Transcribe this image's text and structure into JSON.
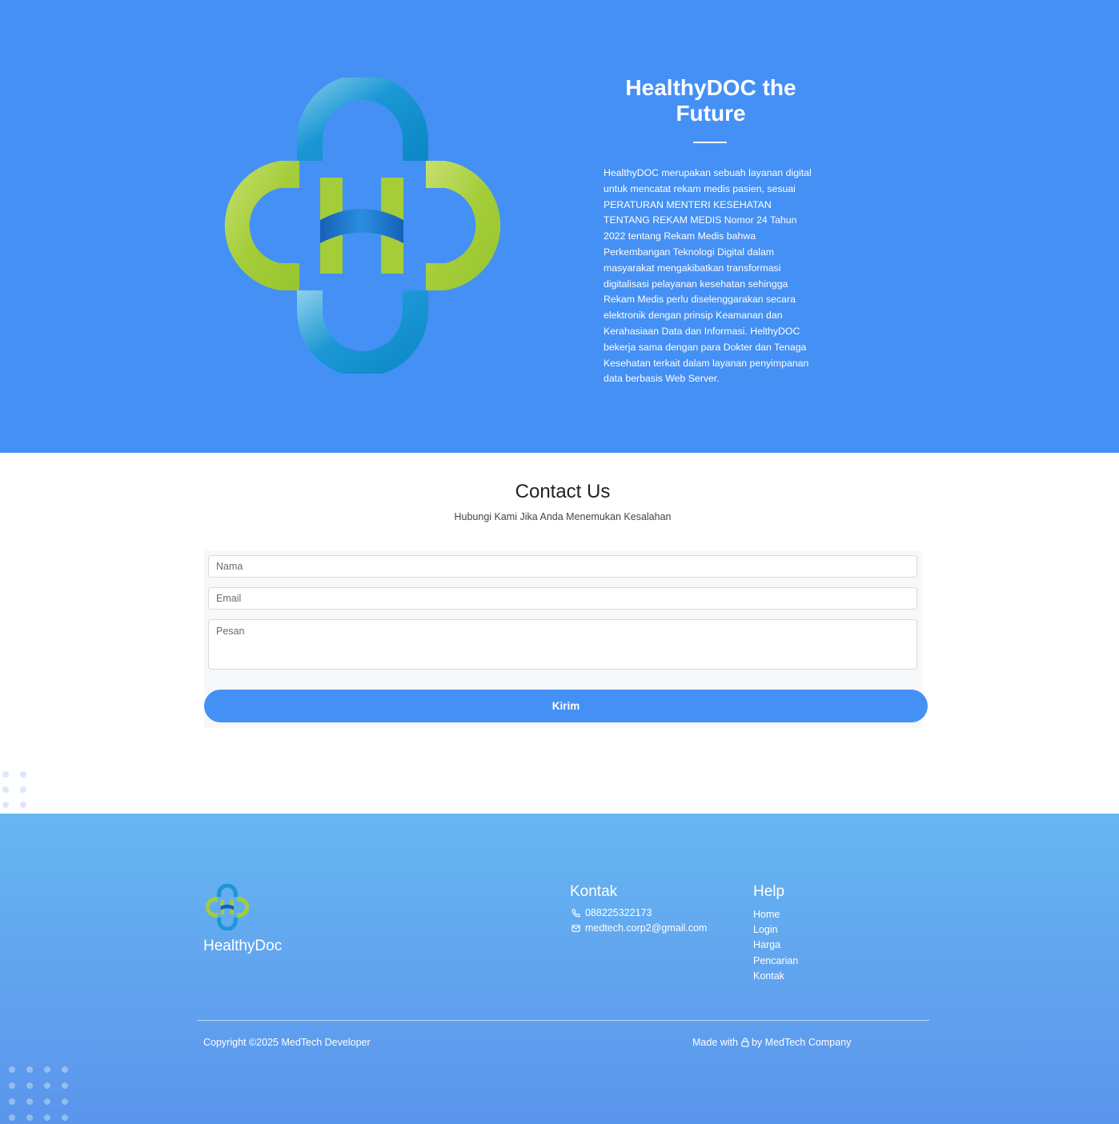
{
  "hero": {
    "title": "HealthyDOC the Future",
    "description": "HealthyDOC merupakan sebuah layanan digital untuk mencatat rekam medis pasien, sesuai PERATURAN MENTERI KESEHATAN TENTANG REKAM MEDIS Nomor 24 Tahun 2022 tentang Rekam Medis bahwa Perkembangan Teknologi Digital dalam masyarakat mengakibatkan transformasi digitalisasi pelayanan kesehatan sehingga Rekam Medis perlu diselenggarakan secara elektronik dengan prinsip Keamanan dan Kerahasiaan Data dan Informasi. HelthyDOC bekerja sama dengan para Dokter dan Tenaga Kesehatan terkait dalam layanan penyimpanan data berbasis Web Server.",
    "logo_icon": "healthydoc-logo-icon"
  },
  "contact": {
    "title": "Contact Us",
    "subtitle": "Hubungi Kami Jika Anda Menemukan Kesalahan",
    "fields": {
      "name_placeholder": "Nama",
      "email_placeholder": "Email",
      "message_placeholder": "Pesan"
    },
    "submit_label": "Kirim"
  },
  "footer": {
    "brand": "HealthyDoc",
    "kontak": {
      "heading": "Kontak",
      "phone": "088225322173",
      "email": "medtech.corp2@gmail.com",
      "phone_icon": "phone-icon",
      "email_icon": "mail-icon"
    },
    "help": {
      "heading": "Help",
      "links": [
        "Home",
        "Login",
        "Harga",
        "Pencarian",
        "Kontak"
      ]
    },
    "copyright": "Copyright ©2025 MedTech Developer",
    "made_with_prefix": "Made with",
    "made_with_suffix": "by MedTech Company",
    "made_with_icon": "lock-icon"
  },
  "colors": {
    "hero_bg": "#4590f4",
    "button_bg": "#4590f4",
    "footer_top": "#66b7f1",
    "footer_bottom": "#5a95ec",
    "logo_green": "#a4cd39",
    "logo_blue": "#1190d0"
  }
}
